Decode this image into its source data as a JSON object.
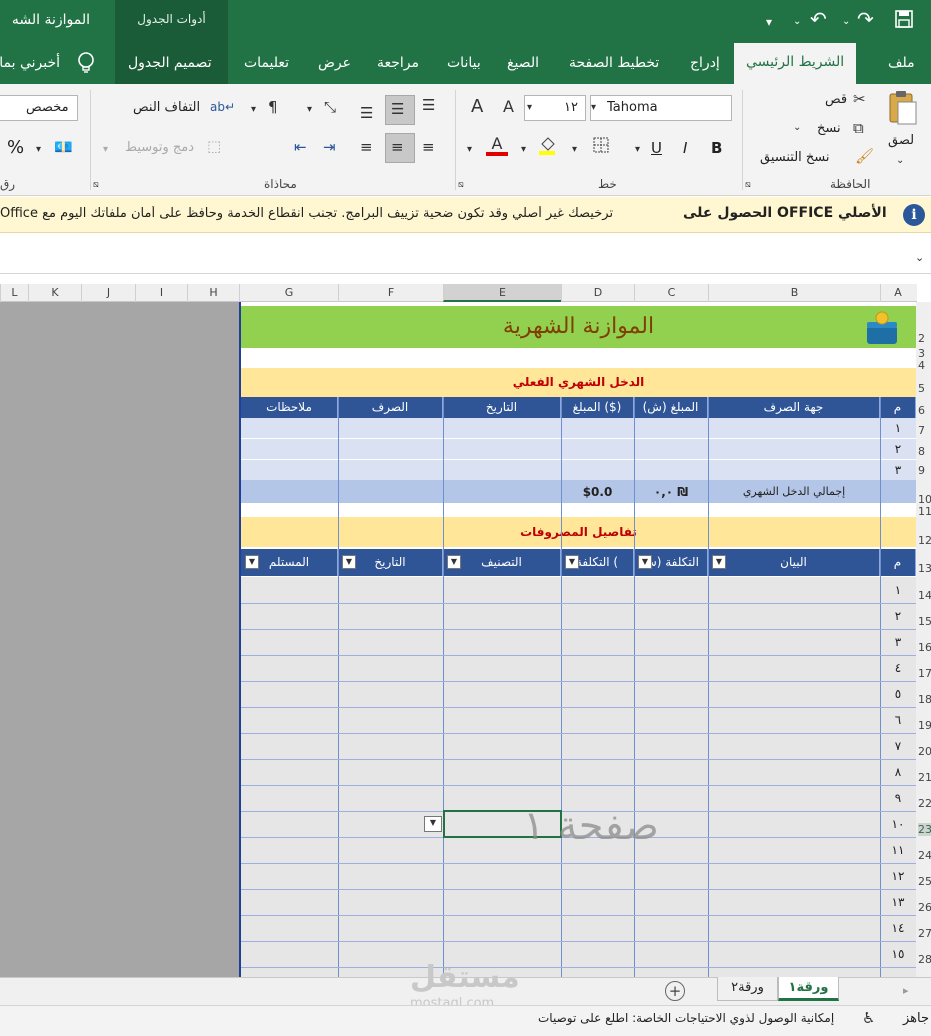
{
  "titlebar": {
    "app_title": "الموازنة الشه",
    "context_tab": "أدوات الجدول",
    "save_icon": "save-icon",
    "undo_icon": "undo-icon",
    "redo_icon": "redo-icon",
    "customize_icon": "customize-icon"
  },
  "tabs": [
    "ملف",
    "الشريط الرئيسي",
    "إدراج",
    "تخطيط الصفحة",
    "الصيغ",
    "بيانات",
    "مراجعة",
    "عرض",
    "تعليمات",
    "تصميم الجدول",
    "أخبرني بما"
  ],
  "active_tab": "الشريط الرئيسي",
  "ribbon": {
    "clipboard": {
      "paste": "لصق",
      "cut": "قص",
      "copy": "نسخ",
      "format_painter": "نسخ التنسيق",
      "label": "الحافظة"
    },
    "font": {
      "name": "Tahoma",
      "size": "١٢",
      "bold": "B",
      "italic": "I",
      "underline": "U",
      "label": "خط",
      "grow": "A",
      "shrink": "A",
      "font_color": "A"
    },
    "alignment": {
      "wrap_text": "التفاف النص",
      "merge_center": "دمج وتوسيط",
      "label": "محاذاة"
    },
    "number": {
      "format": "مخصص",
      "percent": "%",
      "label": "رق"
    }
  },
  "infobar": {
    "title": "الحصول على OFFICE الأصلي",
    "message": "ترخيصك غير أصلي وقد تكون ضحية تزييف البرامج. تجنب انقطاع الخدمة وحافظ على أمان ملفاتك اليوم مع Office"
  },
  "columns": [
    "A",
    "B",
    "C",
    "D",
    "E",
    "F",
    "G",
    "H",
    "I",
    "J",
    "K",
    "L"
  ],
  "rows": [
    "2",
    "3",
    "4",
    "5",
    "6",
    "7",
    "8",
    "9",
    "10",
    "11",
    "12",
    "13",
    "14",
    "15",
    "16",
    "17",
    "18",
    "19",
    "20",
    "21",
    "22",
    "23",
    "24",
    "25",
    "26",
    "27",
    "28"
  ],
  "sheet": {
    "title": "الموازنة الشهرية",
    "income_header": "الدخل الشهري الفعلي",
    "income_columns": [
      "م",
      "جهة الصرف",
      "المبلغ (ش)",
      "المبلغ ($)",
      "التاريخ",
      "الصرف",
      "ملاحظات"
    ],
    "income_rows": [
      "١",
      "٢",
      "٣"
    ],
    "income_total_label": "إجمالي الدخل الشهري",
    "income_total_ils": "٠,٠ ₪",
    "income_total_usd": "$0.0",
    "expenses_header": "تفاصيل المصروفات",
    "expense_columns": [
      "م",
      "البيان",
      "التكلفة (ش",
      "التكلفة (",
      "التصنيف",
      "التاريخ",
      "المستلم"
    ],
    "expense_rows": [
      "١",
      "٢",
      "٣",
      "٤",
      "٥",
      "٦",
      "٧",
      "٨",
      "٩",
      "١٠",
      "١١",
      "١٢",
      "١٣",
      "١٤",
      "١٥"
    ],
    "page_watermark": "صفحة ١"
  },
  "sheet_tabs": [
    "ورقة١",
    "ورقة٢"
  ],
  "active_sheet": "ورقة١",
  "status": {
    "ready": "جاهز",
    "accessibility": "إمكانية الوصول لذوي الاحتياجات الخاصة: اطلع على توصيات"
  },
  "watermark": {
    "brand": "مستقل",
    "site": "mostaql.com"
  },
  "colors": {
    "excel_green": "#217346",
    "header_blue": "#2f5597",
    "title_green": "#92d050",
    "section_yellow": "#ffe699",
    "title_text": "#7f3f00",
    "section_text": "#c00000"
  }
}
